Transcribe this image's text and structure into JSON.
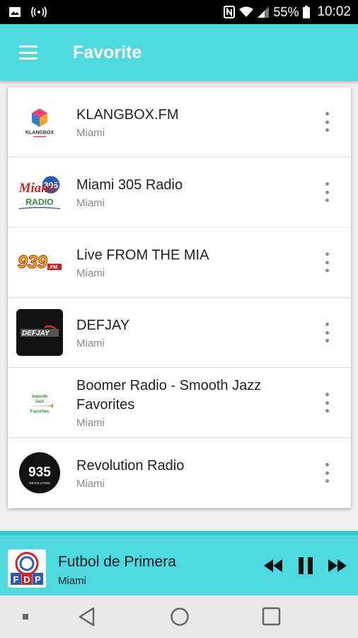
{
  "status_bar": {
    "battery": "55%",
    "time": "10:02",
    "icons": [
      "gallery-icon",
      "broadcast-icon",
      "nfc-icon",
      "wifi-icon",
      "signal-icon",
      "battery-icon"
    ]
  },
  "app_bar": {
    "title": "Favorite",
    "menu_icon": "hamburger-menu-icon"
  },
  "colors": {
    "accent": "#4ed8e0",
    "accent_dark": "#2fcad3",
    "text_primary": "#222222",
    "text_secondary": "#8a8a8a"
  },
  "stations": [
    {
      "name": "KLANGBOX.FM",
      "location": "Miami",
      "logo": "klangbox-logo"
    },
    {
      "name": "Miami 305 Radio",
      "location": "Miami",
      "logo": "miami-305-radio-logo"
    },
    {
      "name": "Live FROM THE MIA",
      "location": "Miami",
      "logo": "939-fm-logo"
    },
    {
      "name": "DEFJAY",
      "location": "Miami",
      "logo": "defjay-logo"
    },
    {
      "name": "Boomer Radio - Smooth Jazz Favorites",
      "location": "Miami",
      "logo": "boomer-radio-logo"
    },
    {
      "name": "Revolution Radio",
      "location": "Miami",
      "logo": "revolution-935-logo"
    }
  ],
  "player": {
    "title": "Futbol de Primera",
    "location": "Miami",
    "logo": "fdp-logo",
    "controls": [
      "rewind-icon",
      "pause-icon",
      "fast-forward-icon"
    ]
  },
  "nav_bar": {
    "buttons": [
      "recent-dot-icon",
      "back-icon",
      "home-icon",
      "overview-icon"
    ]
  }
}
